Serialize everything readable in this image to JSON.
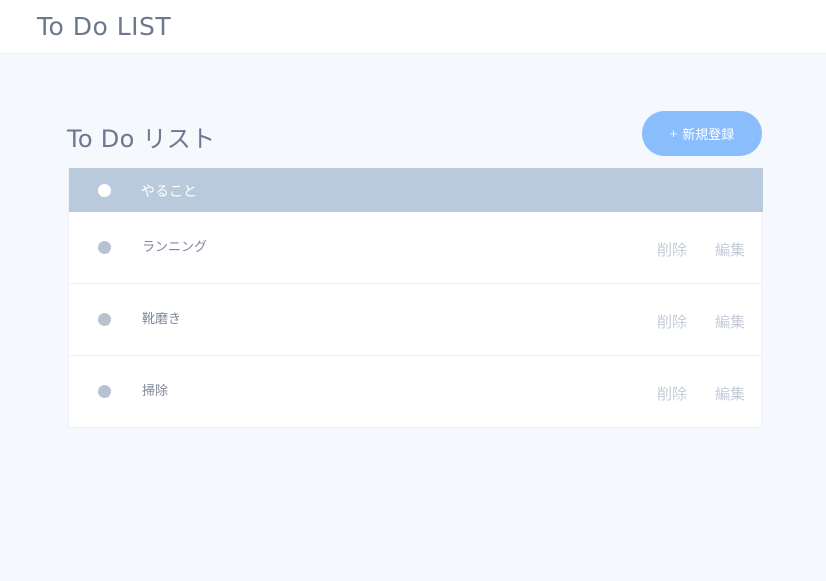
{
  "header": {
    "title": "To Do LIST"
  },
  "main": {
    "title": "To Do リスト",
    "add_button": {
      "icon": "+",
      "label": "新規登録"
    },
    "table": {
      "header_label": "やること",
      "rows": [
        {
          "label": "ランニング",
          "delete": "削除",
          "edit": "編集"
        },
        {
          "label": "靴磨き",
          "delete": "削除",
          "edit": "編集"
        },
        {
          "label": "掃除",
          "delete": "削除",
          "edit": "編集"
        }
      ]
    }
  },
  "colors": {
    "accent": "#89bdfc",
    "table_header": "#b8cadb",
    "background": "#f5f8fd",
    "text": "#6b7890"
  }
}
